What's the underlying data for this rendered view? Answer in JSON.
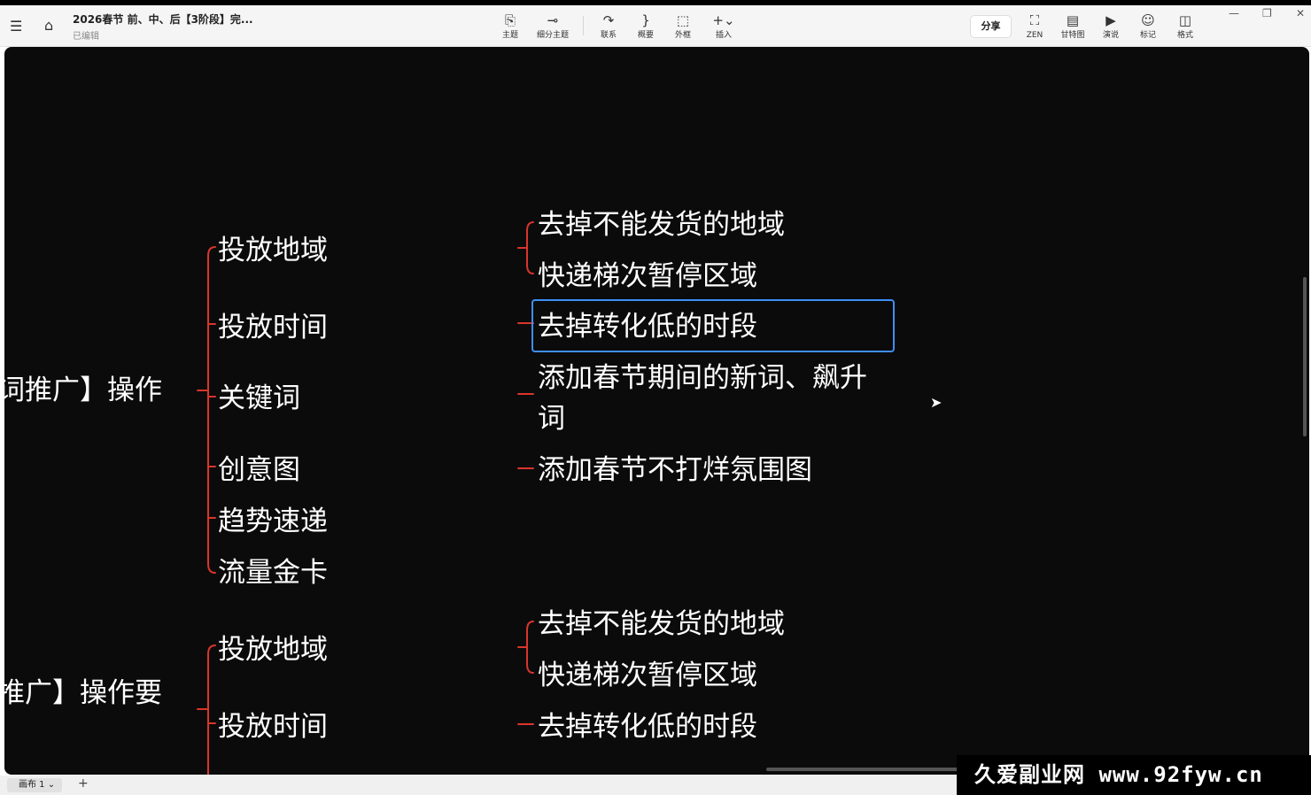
{
  "header": {
    "title": "2026春节 前、中、后【3阶段】完...",
    "status": "已编辑"
  },
  "toolbar": {
    "topic": "主题",
    "subtopic": "细分主题",
    "relation": "联系",
    "summary": "概要",
    "boundary": "外框",
    "insert": "插入"
  },
  "right_toolbar": {
    "share": "分享",
    "zen": "ZEN",
    "gantt": "甘特图",
    "present": "演说",
    "marker": "标记",
    "format": "格式"
  },
  "mindmap": {
    "roots": [
      "词推广】操作",
      "推广】操作要"
    ],
    "group1": [
      "投放地域",
      "投放时间",
      "关键词",
      "创意图",
      "趋势速递",
      "流量金卡"
    ],
    "group1_details": [
      "去掉不能发货的地域",
      "快递梯次暂停区域",
      "去掉转化低的时段",
      "添加春节期间的新词、飙升词",
      "添加春节不打烊氛围图"
    ],
    "group2": [
      "投放地域",
      "投放时间"
    ],
    "group2_details": [
      "去掉不能发货的地域",
      "快递梯次暂停区域",
      "去掉转化低的时段"
    ]
  },
  "bottom": {
    "canvas_tab": "画布 1",
    "add_tab": "+"
  },
  "watermark": "久爱副业网 www.92fyw.cn",
  "colors": {
    "canvas_bg": "#0b0b0c",
    "branch_line": "#d9352b",
    "selection": "#3e8ff6"
  }
}
